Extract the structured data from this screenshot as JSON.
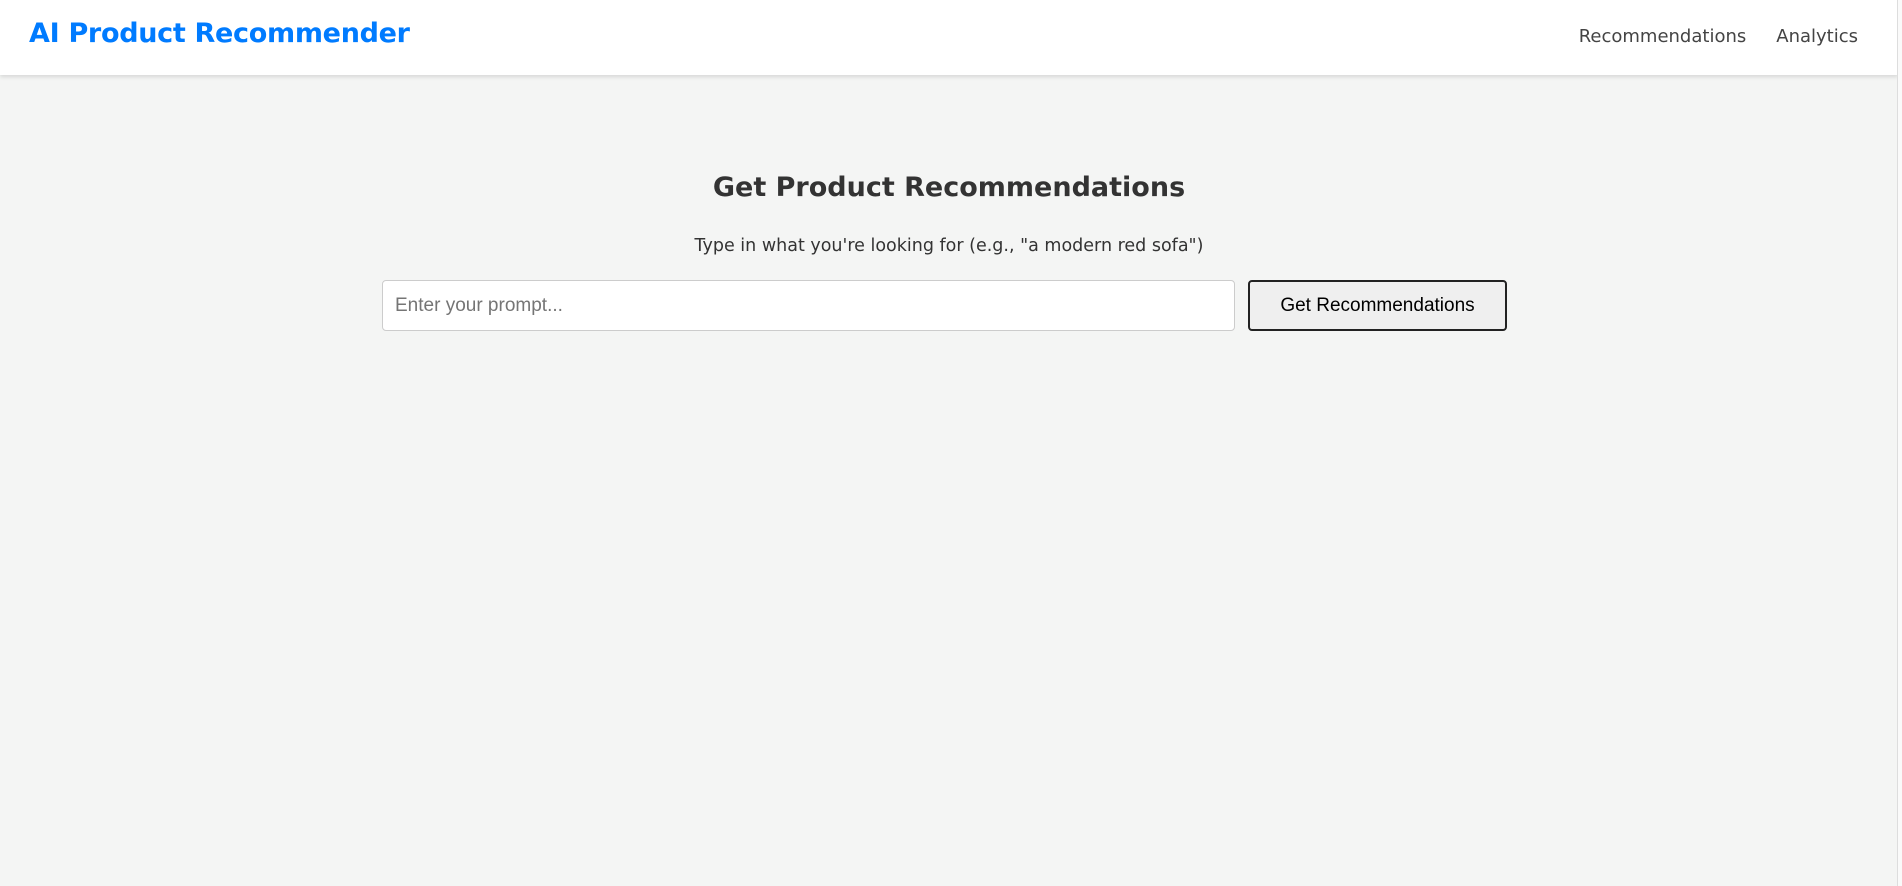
{
  "header": {
    "brand": "AI Product Recommender",
    "nav": [
      {
        "label": "Recommendations"
      },
      {
        "label": "Analytics"
      }
    ],
    "brand_color": "#007bff"
  },
  "main": {
    "title": "Get Product Recommendations",
    "subtitle": "Type in what you're looking for (e.g., \"a modern red sofa\")",
    "prompt_input": {
      "value": "",
      "placeholder": "Enter your prompt..."
    },
    "submit_label": "Get Recommendations"
  }
}
